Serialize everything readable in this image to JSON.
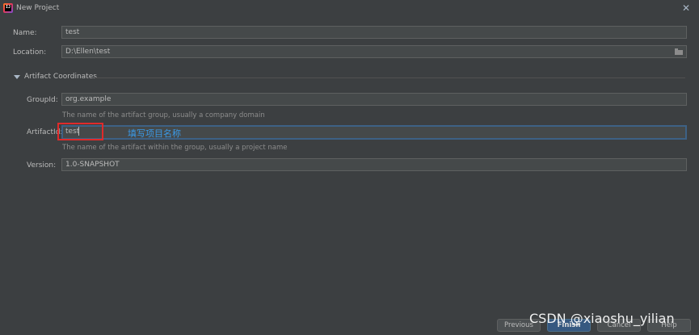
{
  "window": {
    "title": "New Project"
  },
  "form": {
    "name": {
      "label": "Name:",
      "value": "test"
    },
    "location": {
      "label": "Location:",
      "value": "D:\\Ellen\\test"
    }
  },
  "artifact": {
    "section_title": "Artifact Coordinates",
    "group_id": {
      "label": "GroupId:",
      "value": "org.example",
      "hint": "The name of the artifact group, usually a company domain"
    },
    "artifact_id": {
      "label": "ArtifactId:",
      "value": "test",
      "hint": "The name of the artifact within the group, usually a project name"
    },
    "version": {
      "label": "Version:",
      "value": "1.0-SNAPSHOT"
    }
  },
  "annotation": {
    "text": "填写项目名称"
  },
  "buttons": {
    "previous": "Previous",
    "finish": "Finish",
    "cancel": "Cancel",
    "help": "Help"
  },
  "watermark": "CSDN @xiaoshu_yilian",
  "colors": {
    "background": "#3c3f41",
    "field_bg": "#45494a",
    "focus_border": "#3d6185",
    "highlight_red": "#e02a2a",
    "annotation_blue": "#3a9ae8",
    "primary_button": "#365880"
  },
  "icons": {
    "app": "intellij-idea-icon",
    "close": "close-icon",
    "folder": "folder-icon",
    "expand": "triangle-down-icon"
  }
}
